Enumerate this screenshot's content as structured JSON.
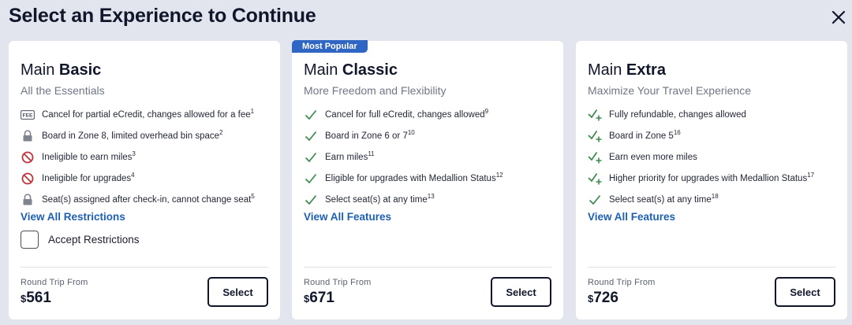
{
  "modal": {
    "title": "Select an Experience to Continue"
  },
  "colors": {
    "accent_blue": "#1d5fb3",
    "badge_blue": "#2f66c3",
    "check_green": "#3a8a4e",
    "restriction_red": "#c0333b",
    "background": "#e3e5ee"
  },
  "cards": [
    {
      "title_prefix": "Main",
      "title_strong": "Basic",
      "subtitle": "All the Essentials",
      "features": [
        {
          "icon": "fee-icon",
          "text": "Cancel for partial eCredit, changes allowed for a fee",
          "sup": "1"
        },
        {
          "icon": "lock-icon",
          "text": "Board in Zone 8, limited overhead bin space",
          "sup": "2"
        },
        {
          "icon": "prohibited-icon",
          "text": "Ineligible to earn miles",
          "sup": "3"
        },
        {
          "icon": "prohibited-icon",
          "text": "Ineligible for upgrades",
          "sup": "4"
        },
        {
          "icon": "lock-icon",
          "text": "Seat(s) assigned after check-in, cannot change seat",
          "sup": "5"
        }
      ],
      "link": "View All Restrictions",
      "accept_label": "Accept Restrictions",
      "from_label": "Round Trip From",
      "currency": "$",
      "price": "561",
      "button": "Select"
    },
    {
      "badge": "Most Popular",
      "title_prefix": "Main",
      "title_strong": "Classic",
      "subtitle": "More Freedom and Flexibility",
      "features": [
        {
          "icon": "check-icon",
          "text": "Cancel for full eCredit, changes allowed",
          "sup": "9"
        },
        {
          "icon": "check-icon",
          "text": "Board in Zone 6 or 7",
          "sup": "10"
        },
        {
          "icon": "check-icon",
          "text": "Earn miles",
          "sup": "11"
        },
        {
          "icon": "check-icon",
          "text": "Eligible for upgrades with Medallion Status",
          "sup": "12"
        },
        {
          "icon": "check-icon",
          "text": "Select seat(s) at any time",
          "sup": "13"
        }
      ],
      "link": "View All Features",
      "from_label": "Round Trip From",
      "currency": "$",
      "price": "671",
      "button": "Select"
    },
    {
      "title_prefix": "Main",
      "title_strong": "Extra",
      "subtitle": "Maximize Your Travel Experience",
      "features": [
        {
          "icon": "check-plus-icon",
          "text": "Fully refundable, changes allowed",
          "sup": ""
        },
        {
          "icon": "check-plus-icon",
          "text": "Board in Zone 5",
          "sup": "16"
        },
        {
          "icon": "check-plus-icon",
          "text": "Earn even more miles",
          "sup": ""
        },
        {
          "icon": "check-plus-icon",
          "text": "Higher priority for upgrades with Medallion Status",
          "sup": "17"
        },
        {
          "icon": "check-icon",
          "text": "Select seat(s) at any time",
          "sup": "18"
        }
      ],
      "link": "View All Features",
      "from_label": "Round Trip From",
      "currency": "$",
      "price": "726",
      "button": "Select"
    }
  ]
}
